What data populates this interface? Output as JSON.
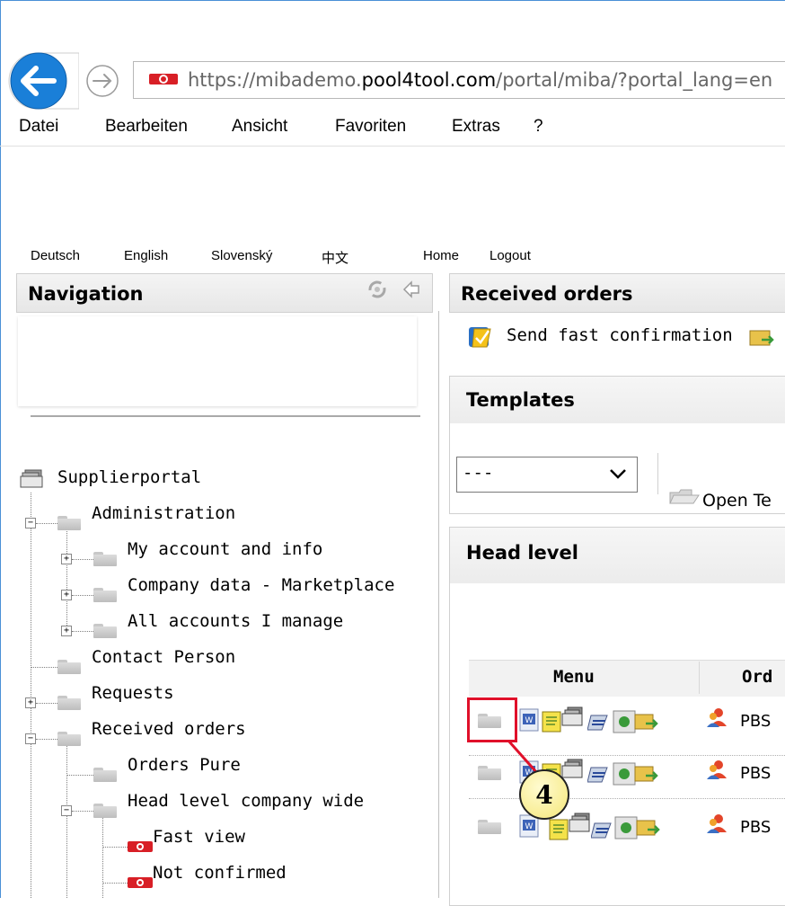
{
  "browser": {
    "url_prefix": "https://",
    "url_sub": "mibademo.",
    "url_domain": "pool4tool.com",
    "url_path": "/portal/miba/?portal_lang=en",
    "addr_badge": "P4T"
  },
  "menubar": {
    "items": [
      "Datei",
      "Bearbeiten",
      "Ansicht",
      "Favoriten",
      "Extras",
      "?"
    ]
  },
  "langbar": {
    "items": [
      "Deutsch",
      "English",
      "Slovenský",
      "中文",
      "Home",
      "Logout"
    ]
  },
  "navigation": {
    "title": "Navigation",
    "tree": {
      "root": "Supplierportal",
      "administration": "Administration",
      "my_account": "My account and info",
      "company_data": "Company data - Marketplace",
      "all_accounts": "All accounts I manage",
      "contact_person": "Contact Person",
      "requests": "Requests",
      "received_orders": "Received orders",
      "orders_pure": "Orders Pure",
      "head_level_company": "Head level company wide",
      "fast_view": "Fast view",
      "not_confirmed": "Not confirmed"
    }
  },
  "main": {
    "title": "Received orders",
    "send_fast_confirmation": "Send fast confirmation",
    "templates": {
      "title": "Templates",
      "select_value": "---",
      "open_button": "Open Te"
    },
    "head_level": {
      "title": "Head level",
      "col_menu": "Menu",
      "col_order": "Ord",
      "rows": [
        {
          "order": "PBS"
        },
        {
          "order": "PBS"
        },
        {
          "order": "PBS"
        }
      ]
    },
    "callout_number": "4"
  },
  "colors": {
    "browser_accent": "#1a7fd8",
    "highlight": "#e0102a",
    "callout_fill": "#f5e77a"
  }
}
